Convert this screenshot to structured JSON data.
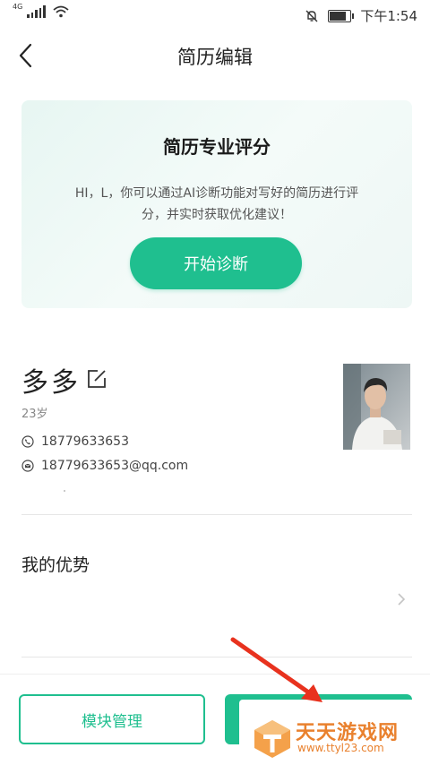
{
  "status_bar": {
    "network": "4G",
    "time": "下午1:54"
  },
  "nav": {
    "title": "简历编辑"
  },
  "diagnosis": {
    "title": "简历专业评分",
    "description": "HI，L，你可以通过AI诊断功能对写好的简历进行评分，并实时获取优化建议！",
    "button_label": "开始诊断"
  },
  "profile": {
    "name": "多多",
    "age": "23岁",
    "phone": "18779633653",
    "email": "18779633653@qq.com"
  },
  "sections": {
    "advantage_title": "我的优势"
  },
  "bottom": {
    "module_button": "模块管理"
  },
  "watermark": {
    "title": "天天游戏网",
    "url": "www.ttyl23.com"
  },
  "colors": {
    "accent": "#1fbf8f",
    "card_bg": "#e9f7f3",
    "arrow": "#e8321e",
    "watermark": "#e9812e"
  },
  "icons": [
    "back-arrow-icon",
    "edit-icon",
    "phone-icon",
    "email-icon",
    "chevron-right-icon",
    "signal-icon",
    "wifi-icon",
    "mute-bell-icon",
    "battery-icon"
  ]
}
